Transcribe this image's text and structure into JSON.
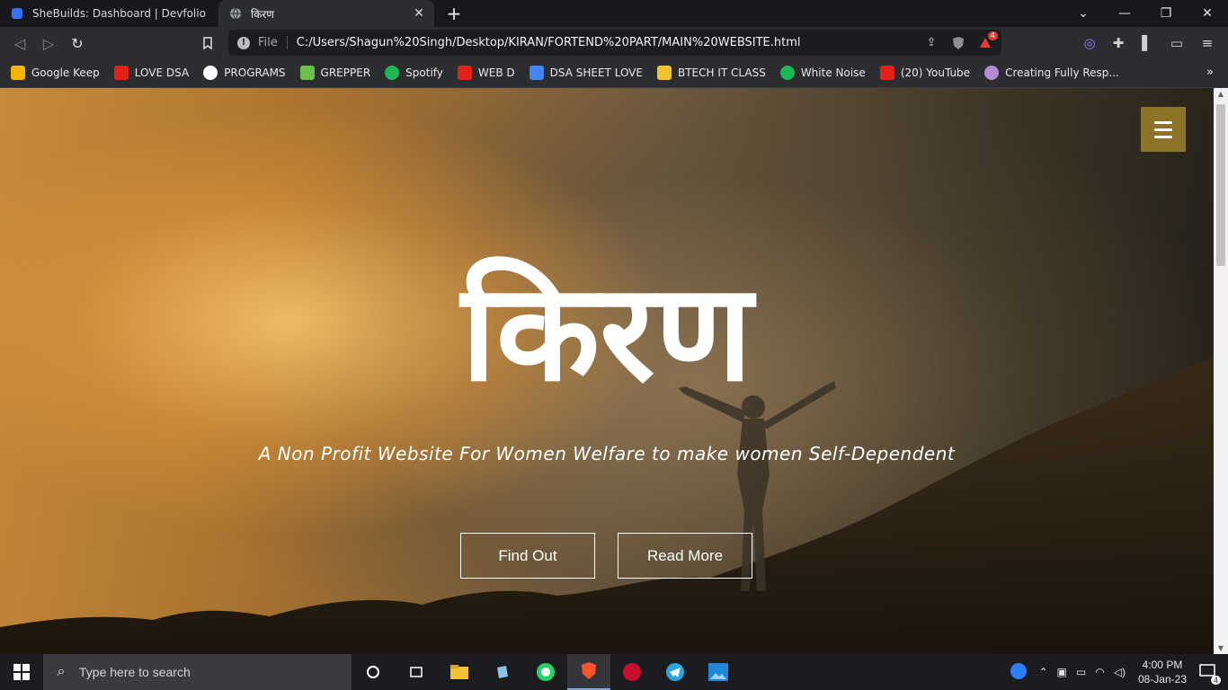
{
  "browser": {
    "tabs": [
      {
        "title": "SheBuilds: Dashboard | Devfolio",
        "active": false
      },
      {
        "title": "किरण",
        "active": true
      }
    ],
    "address": {
      "scheme": "File",
      "url": "C:/Users/Shagun%20Singh/Desktop/KIRAN/FORTEND%20PART/MAIN%20WEBSITE.html"
    },
    "notification_count": "4",
    "bookmarks": [
      {
        "label": "Google Keep",
        "color": "#f4b400"
      },
      {
        "label": "LOVE DSA",
        "color": "#e62117"
      },
      {
        "label": "PROGRAMS",
        "color": "#ffffff"
      },
      {
        "label": "GREPPER",
        "color": "#6cc04a"
      },
      {
        "label": "Spotify",
        "color": "#1db954"
      },
      {
        "label": "WEB D",
        "color": "#e62117"
      },
      {
        "label": "DSA SHEET LOVE",
        "color": "#4285f4"
      },
      {
        "label": "BTECH IT CLASS",
        "color": "#f2c230"
      },
      {
        "label": "White Noise",
        "color": "#1db954"
      },
      {
        "label": "(20) YouTube",
        "color": "#e62117"
      },
      {
        "label": "Creating Fully Resp...",
        "color": "#b48ad0"
      }
    ]
  },
  "page": {
    "title": "किरण",
    "subtitle": "A Non Profit Website For Women Welfare to make women Self-Dependent",
    "buttons": [
      "Find Out",
      "Read More"
    ],
    "accent_color": "#8c7327"
  },
  "taskbar": {
    "search_placeholder": "Type here to search",
    "time": "4:00 PM",
    "date": "08-Jan-23",
    "notification_count": "4"
  }
}
